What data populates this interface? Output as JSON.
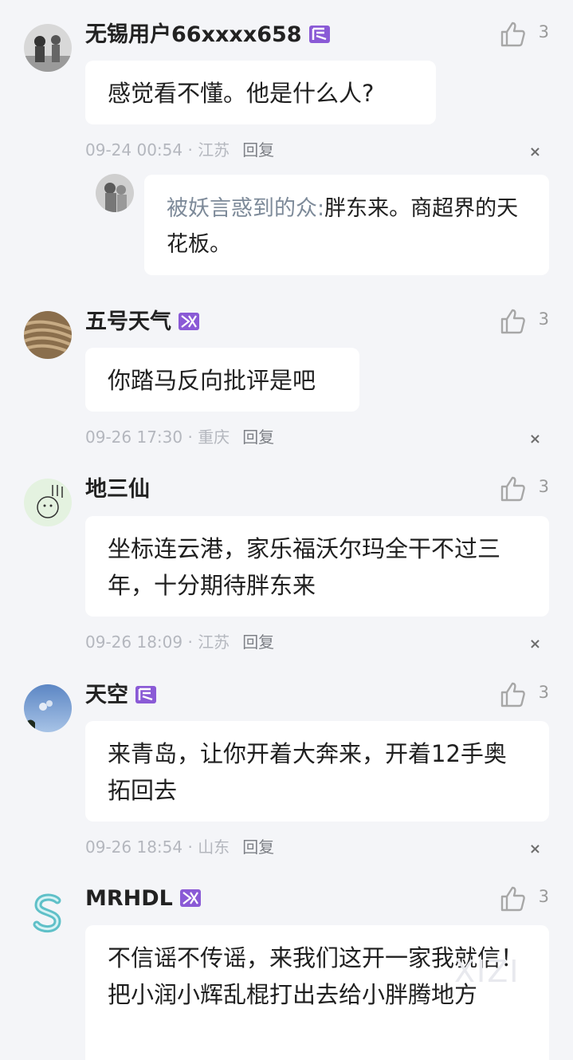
{
  "comments": [
    {
      "username": "无锡用户66xxxx658",
      "likes": "3",
      "text": "感觉看不懂。他是什么人?",
      "date": "09-24 00:54",
      "location": "江苏",
      "reply_label": "回复",
      "reply": {
        "author": "被妖言惑到的众:",
        "text": "胖东来。商超界的天花板。"
      }
    },
    {
      "username": "五号天气",
      "likes": "3",
      "text": "你踏马反向批评是吧",
      "date": "09-26 17:30",
      "location": "重庆",
      "reply_label": "回复"
    },
    {
      "username": "地三仙",
      "likes": "3",
      "text": "坐标连云港，家乐福沃尔玛全干不过三年，十分期待胖东来",
      "date": "09-26 18:09",
      "location": "江苏",
      "reply_label": "回复"
    },
    {
      "username": "天空",
      "likes": "3",
      "text": "来青岛，让你开着大奔来，开着12手奥拓回去",
      "date": "09-26 18:54",
      "location": "山东",
      "reply_label": "回复"
    },
    {
      "username": "MRHDL",
      "likes": "3",
      "text": "不信谣不传谣，来我们这开一家我就信！把小润小辉乱棍打出去给小胖腾地方"
    }
  ],
  "meta_separator": " · ",
  "close_glyph": "×",
  "watermark": "XIZI",
  "colors": {
    "badge": "#7b4fc9",
    "like_icon": "#a7a7a7",
    "page_bg": "#f4f5f8"
  }
}
